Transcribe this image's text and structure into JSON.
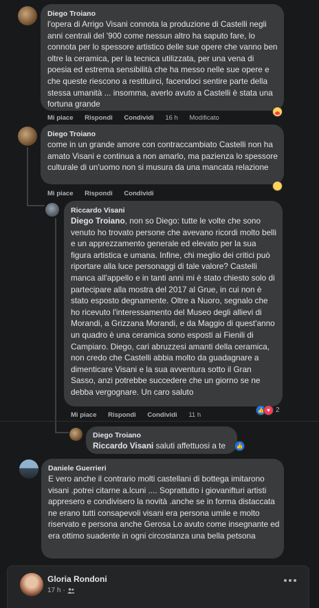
{
  "comments": {
    "c1": {
      "author": "Diego Troiano",
      "text": "l'opera di Arrigo Visani connota la produzione di Castelli negli anni centrali del '900 come nessun altro ha saputo fare, lo connota per lo spessore artistico delle sue opere che vanno ben oltre la ceramica, per la tecnica utilizzata, per una vena di poesia ed estrema sensibilità che ha messo nelle sue opere e che queste riescono a restituirci, facendoci sentire parte della stessa umanità ... insomma, averlo avuto a Castelli è stata una fortuna grande",
      "like": "Mi piace",
      "reply": "Rispondi",
      "share": "Condividi",
      "time": "16 h",
      "edited": "Modificato",
      "reaction_icon": "care-reaction-icon"
    },
    "c2": {
      "author": "Diego Troiano",
      "text": "come in un grande amore con contraccambiato Castelli non ha amato Visani e continua a non amarlo, ma pazienza lo spessore culturale di un'uomo non si musura da una mancata relazione",
      "like": "Mi piace",
      "reply": "Rispondi",
      "share": "Condividi",
      "reaction_icon": "sad-reaction-icon"
    },
    "c3": {
      "author": "Riccardo Visani",
      "mention": "Diego Troiano",
      "text": ", non so Diego: tutte le volte che sono venuto ho trovato persone che avevano ricordi molto belli e un apprezzamento generale ed elevato per la sua figura artistica e umana. Infine, chi meglio dei critici può riportare alla luce personaggi di tale valore? Castelli manca all'appello e in tanti anni mi è stato chiesto solo di partecipare alla mostra del 2017 al Grue, in cui non è stato esposto degnamente. Oltre a Nuoro, segnalo che ho ricevuto l'interessamento del Museo degli allievi di Morandi, a Grizzana Morandi, e da Maggio di quest'anno un quadro è una ceramica sono esposti ai Fienili di Campiaro. Diego, cari abruzzesi amanti della ceramica, non credo che Castelli abbia molto da guadagnare a dimenticare Visani e la sua avventura sotto il Gran Sasso, anzi potrebbe succedere che un giorno se ne debba vergognare. Un caro saluto",
      "like": "Mi piace",
      "reply": "Rispondi",
      "share": "Condividi",
      "time": "11 h",
      "reaction_count": "2"
    },
    "c4": {
      "author": "Diego Troiano",
      "mention": "Riccardo Visani",
      "text": " saluti affettuosi a te"
    },
    "c5": {
      "author": "Daniele Guerrieri",
      "text": "E vero anche il contrario molti castellani di bottega imitarono visani .potrei citarne a.lcuni .... Soprattutto i giovanifturi artisti appresero e condivisero la novità .anche se in forma distaccata ne erano tutti consapevoli visani era persona umile e molto riservato e persona anche Gerosa Lo avuto come insegnante ed era ottimo suadente in ogni circostanza una bella petsona"
    }
  },
  "post": {
    "author": "Gloria Rondoni",
    "time": "17 h",
    "separator": "·",
    "more_icon": "more-dots-icon",
    "audience_icon": "friends-icon"
  },
  "colors": {
    "background": "#18191a",
    "bubble": "#3a3b3c",
    "like_blue": "#1877f2",
    "love_red": "#f33e58",
    "haha_yellow": "#f7b125"
  }
}
